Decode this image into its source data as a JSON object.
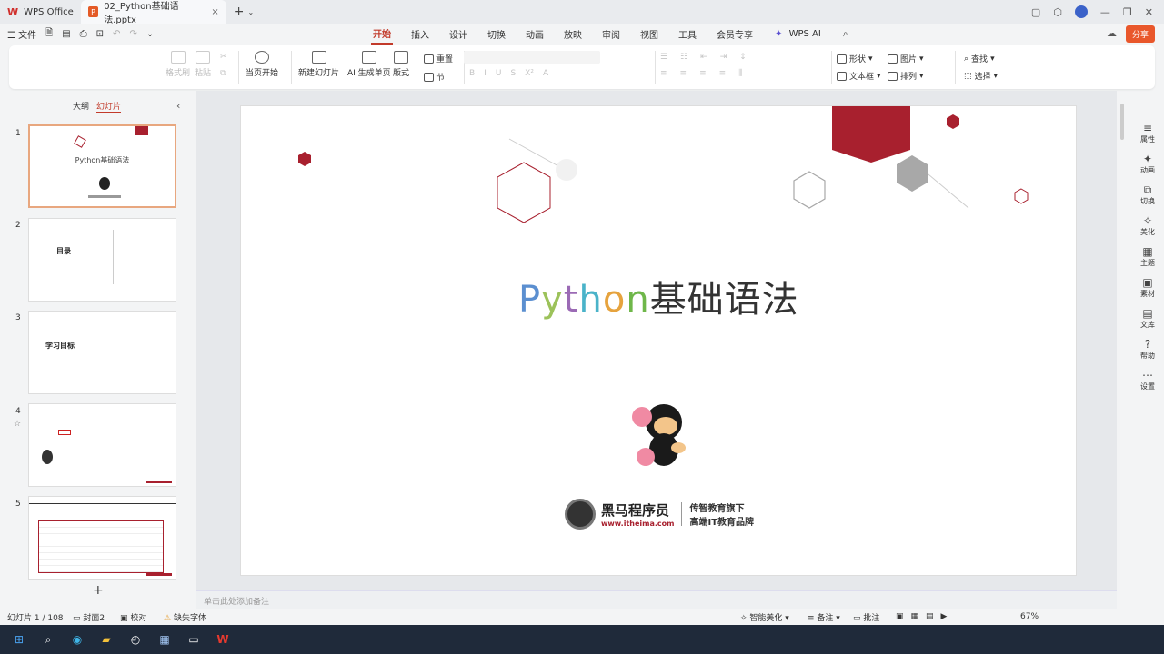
{
  "titlebar": {
    "app_tab": "WPS Office",
    "doc_tab": "02_Python基础语法.pptx",
    "close_glyph": "×",
    "new_tab": "+"
  },
  "menubar": {
    "file": "文件",
    "tabs": [
      "开始",
      "插入",
      "设计",
      "切换",
      "动画",
      "放映",
      "审阅",
      "视图",
      "工具",
      "会员专享",
      "WPS AI"
    ],
    "active_tab": "开始",
    "share": "分享"
  },
  "ribbon": {
    "paste_style": "格式刷",
    "paste": "粘贴",
    "from_current": "当页开始",
    "new_slide": "新建幻灯片",
    "ai_single": "AI 生成单页",
    "layout": "版式",
    "reset": "重置",
    "section": "节",
    "shape": "形状",
    "picture": "图片",
    "textbox": "文本框",
    "arrange": "排列",
    "find": "查找",
    "select": "选择"
  },
  "left_panel": {
    "tab_outline": "大纲",
    "tab_slides": "幻灯片",
    "slide_numbers": [
      "1",
      "2",
      "3",
      "4",
      "5"
    ],
    "thumb1_title": "Python基础语法",
    "thumb2_title": "目录",
    "thumb3_title": "学习目标",
    "add": "+"
  },
  "slide": {
    "title_py": [
      "P",
      "y",
      "t",
      "h",
      "o",
      "n"
    ],
    "title_cn": "基础语法",
    "brand_name": "黑马程序员",
    "brand_url": "www.itheima.com",
    "brand_slogan1": "传智教育旗下",
    "brand_slogan2": "高端IT教育品牌",
    "colors": {
      "accent_red": "#a8202e",
      "hex_gray": "#a8a8a8",
      "p": "#5b8fd0",
      "y": "#9cc25a",
      "t": "#9b6ab5",
      "h": "#4ab3c9",
      "o": "#e6a33e",
      "n": "#6fb74a"
    }
  },
  "notes_placeholder": "单击此处添加备注",
  "right_panel": [
    {
      "label": "属性",
      "icon": "≡"
    },
    {
      "label": "动画",
      "icon": "✦"
    },
    {
      "label": "切换",
      "icon": "⧉"
    },
    {
      "label": "美化",
      "icon": "✧"
    },
    {
      "label": "主题",
      "icon": "▦"
    },
    {
      "label": "素材",
      "icon": "▣"
    },
    {
      "label": "文库",
      "icon": "▤"
    },
    {
      "label": "帮助",
      "icon": "?"
    },
    {
      "label": "设置",
      "icon": "⋯"
    }
  ],
  "statusbar": {
    "slide_counter": "幻灯片 1 / 108",
    "theme": "封面2",
    "proof": "校对",
    "missing_font": "缺失字体",
    "smart": "智能美化",
    "notes": "备注",
    "comments": "批注",
    "zoom": "67%"
  }
}
